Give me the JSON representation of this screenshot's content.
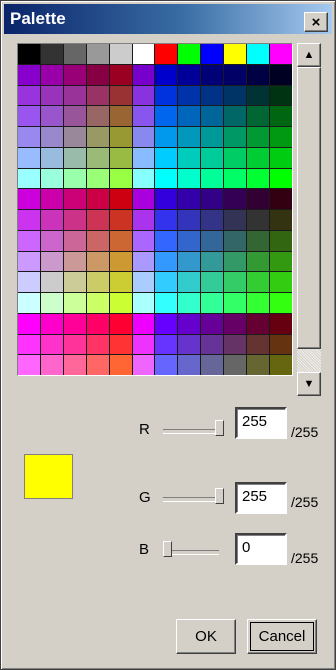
{
  "window": {
    "title": "Palette",
    "close_label": "×"
  },
  "palette": {
    "colors": [
      "#000000",
      "#333333",
      "#666666",
      "#999999",
      "#cccccc",
      "#ffffff",
      "#ff0000",
      "#00ff00",
      "#0000ff",
      "#ffff00",
      "#00ffff",
      "#ff00ff",
      "#8800cc",
      "#9900aa",
      "#990077",
      "#880044",
      "#990022",
      "#7700cc",
      "#0000cc",
      "#000099",
      "#000077",
      "#000066",
      "#000044",
      "#000022",
      "#9933dd",
      "#9933bb",
      "#993399",
      "#993366",
      "#993333",
      "#8833dd",
      "#0033dd",
      "#0033aa",
      "#003388",
      "#003366",
      "#003333",
      "#003311",
      "#9955ee",
      "#9955cc",
      "#995599",
      "#996666",
      "#996633",
      "#8855ee",
      "#0066ee",
      "#0066bb",
      "#006699",
      "#006666",
      "#006633",
      "#006611",
      "#9988ee",
      "#9988cc",
      "#998899",
      "#999966",
      "#999933",
      "#8888ee",
      "#0099ee",
      "#0099bb",
      "#009999",
      "#009966",
      "#009933",
      "#009911",
      "#99bbff",
      "#99bbdd",
      "#99bbaa",
      "#99bb77",
      "#99bb44",
      "#88bbff",
      "#00ccff",
      "#00ccbb",
      "#00cc99",
      "#00cc66",
      "#00cc33",
      "#00cc11",
      "#99ffff",
      "#99ffdd",
      "#99ffaa",
      "#99ff77",
      "#99ff44",
      "#88ffff",
      "#00ffff",
      "#00ffcc",
      "#00ff99",
      "#00ff66",
      "#00ff33",
      "#00ff00",
      "#cc00dd",
      "#cc00aa",
      "#cc0077",
      "#cc0044",
      "#cc0011",
      "#aa00dd",
      "#3300dd",
      "#3300aa",
      "#330088",
      "#330055",
      "#330033",
      "#330011",
      "#cc33ee",
      "#cc33bb",
      "#cc3388",
      "#cc3355",
      "#cc3322",
      "#aa33ee",
      "#3333ee",
      "#3333bb",
      "#333388",
      "#333355",
      "#333333",
      "#333311",
      "#cc66ff",
      "#cc66cc",
      "#cc6699",
      "#cc6666",
      "#cc6633",
      "#aa66ff",
      "#3366ff",
      "#3366cc",
      "#336699",
      "#336666",
      "#336633",
      "#336611",
      "#cc99ff",
      "#cc99cc",
      "#cc9999",
      "#cc9966",
      "#cc9933",
      "#aa99ff",
      "#3399ff",
      "#3399cc",
      "#339999",
      "#339966",
      "#339933",
      "#339911",
      "#ccccff",
      "#cccccc",
      "#cccc99",
      "#cccc66",
      "#cccc33",
      "#aaccff",
      "#33ccff",
      "#33cccc",
      "#33cc99",
      "#33cc66",
      "#33cc33",
      "#33cc11",
      "#ccffff",
      "#ccffcc",
      "#ccff99",
      "#ccff66",
      "#ccff33",
      "#aaffff",
      "#33ffff",
      "#33ffcc",
      "#33ff99",
      "#33ff66",
      "#33ff33",
      "#33ff11",
      "#ff00ff",
      "#ff00cc",
      "#ff0099",
      "#ff0066",
      "#ff0033",
      "#ee00ff",
      "#6600ff",
      "#6600cc",
      "#660099",
      "#660066",
      "#660033",
      "#660011",
      "#ff33ff",
      "#ff33cc",
      "#ff3399",
      "#ff3366",
      "#ff3333",
      "#ee33ff",
      "#6633ff",
      "#6633cc",
      "#663399",
      "#663366",
      "#663333",
      "#663311",
      "#ff66ff",
      "#ff66cc",
      "#ff6699",
      "#ff6666",
      "#ff6633",
      "#ee66ff",
      "#6666ff",
      "#6666cc",
      "#666699",
      "#666666",
      "#666633",
      "#666611"
    ]
  },
  "selected_color": "#ffff00",
  "channels": [
    {
      "label": "R",
      "value": "255",
      "max": "/255",
      "level": 1.0
    },
    {
      "label": "G",
      "value": "255",
      "max": "/255",
      "level": 1.0
    },
    {
      "label": "B",
      "value": "0",
      "max": "/255",
      "level": 0.0
    }
  ],
  "buttons": {
    "ok": "OK",
    "cancel": "Cancel"
  },
  "scrollbar": {
    "up_icon": "▲",
    "down_icon": "▼"
  }
}
